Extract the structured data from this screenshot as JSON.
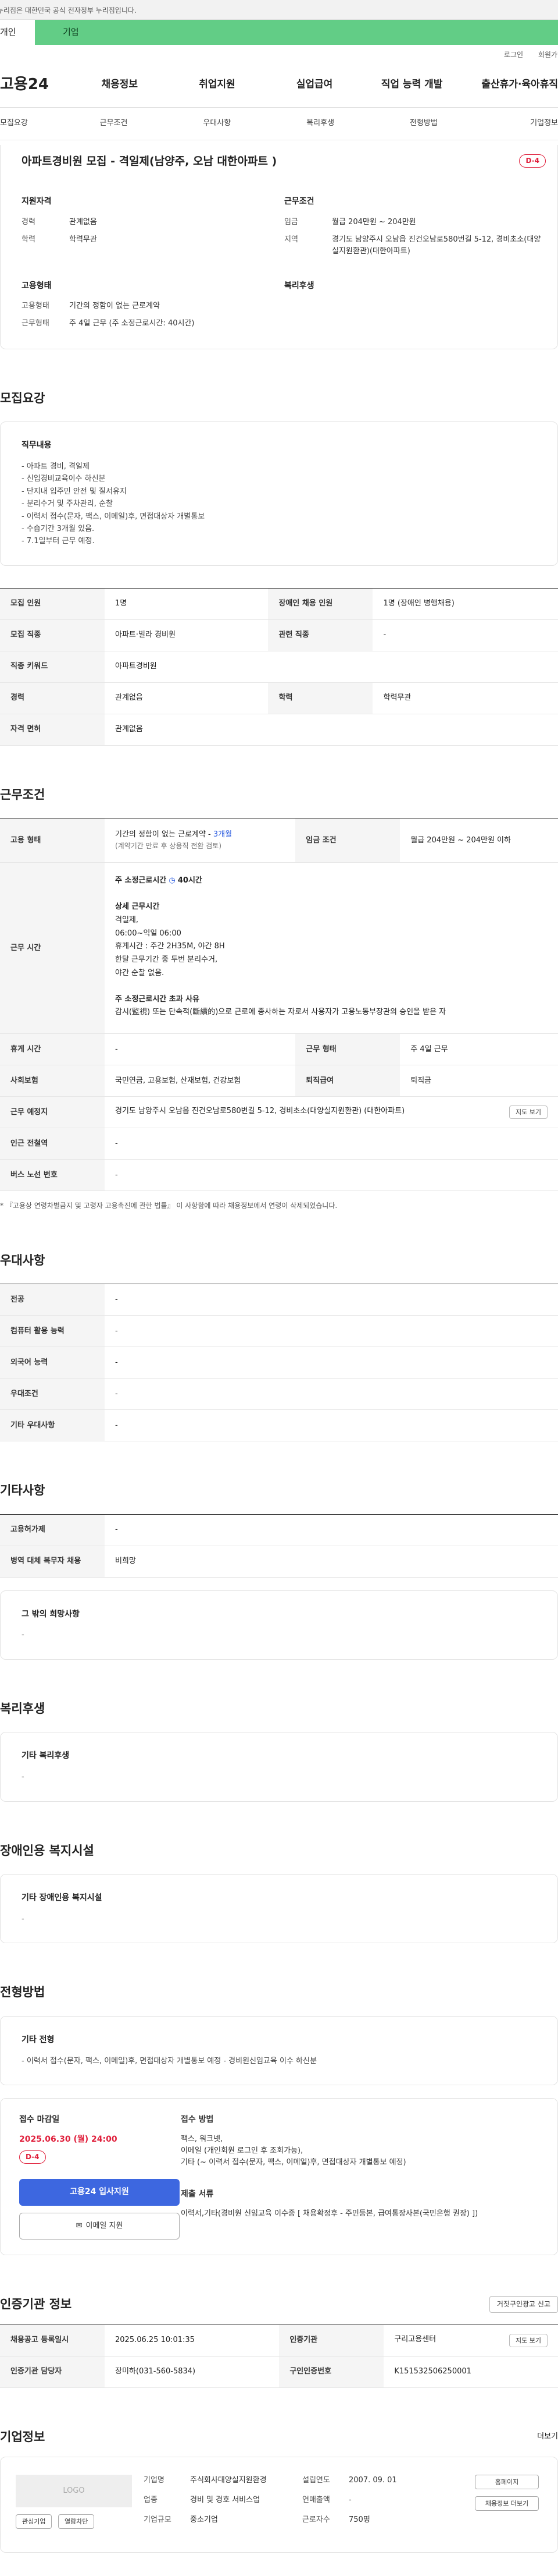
{
  "gov_bar": "이 누리집은 대한민국 공식 전자정부 누리집입니다.",
  "top_tabs": [
    "개인",
    "기업"
  ],
  "util": [
    "로그인",
    "회원가입"
  ],
  "gnb": {
    "logo": "고용24",
    "menus": [
      "채용정보",
      "취업지원",
      "실업급여",
      "직업 능력 개발",
      "출산휴가·육아휴직"
    ]
  },
  "snb": [
    "모집요강",
    "근무조건",
    "우대사항",
    "복리후생",
    "전형방법",
    "기업정보"
  ],
  "summary": {
    "title": "아파트경비원 모집 - 격일제(남양주, 오남 대한아파트 )",
    "dday": "D-4",
    "qual_h": "지원자격",
    "qual": [
      {
        "k": "경력",
        "v": "관계없음"
      },
      {
        "k": "학력",
        "v": "학력무관"
      }
    ],
    "cond_h": "근무조건",
    "cond": [
      {
        "k": "임금",
        "v": "월급 204만원 ~ 204만원"
      },
      {
        "k": "지역",
        "v": "경기도 남양주시 오남읍 진건오남로580번길 5-12, 경비초소(대양실지원환관)(대한아파트)"
      }
    ],
    "emp_h": "고용형태",
    "emp": [
      {
        "k": "고용형태",
        "v": "기간의 정함이 없는 근로계약"
      },
      {
        "k": "근무형태",
        "v": "주 4일 근무 (주 소정근로시간: 40시간)"
      }
    ],
    "welfare_h": "복리후생"
  },
  "recruit": {
    "title": "모집요강",
    "duty_h": "직무내용",
    "duty_lines": [
      "- 아파트 경비, 격일제",
      "- 신입경비교육이수 하신분",
      "- 단지내 입주민 안전 및 질서유지",
      "- 분리수거 및 주차관리, 순찰",
      "- 이력서 접수(문자, 팩스, 이메일)후, 면접대상자 개별통보",
      "- 수습기간 3개월 있음.",
      "- 7.1일부터 근무 예정."
    ],
    "rows": [
      [
        "모집 인원",
        "1명",
        "장애인 채용 인원",
        "1명 (장애인 병행채용)"
      ],
      [
        "모집 직종",
        "아파트·빌라 경비원",
        "관련 직종",
        "-"
      ],
      [
        "직종 키워드",
        "아파트경비원",
        "",
        ""
      ],
      [
        "경력",
        "관계없음",
        "학력",
        "학력무관"
      ],
      [
        "자격 면허",
        "관계없음",
        "",
        ""
      ]
    ]
  },
  "work": {
    "title": "근무조건",
    "emp_k": "고용 형태",
    "emp_v1": "기간의 정함이 없는 근로계약 - ",
    "emp_v1b": "3개월",
    "emp_v2": "(계약기간 만료 후 상용직 전환 검토)",
    "wage_k": "임금 조건",
    "wage_v": "월급 204만원 ~ 204만원 이하",
    "time_k": "근무 시간",
    "time_lines": [
      "주 소정근로시간",
      "40시간",
      "상세 근무시간",
      "격일제,",
      "06:00~익일 06:00",
      "휴게시간 : 주간 2H35M, 야간 8H",
      "한달 근무기간 중 두번 분리수거,",
      "야간 순찰 없음.",
      "주 소정근로시간 초과 사유",
      "감시(監視) 또는 단속적(斷續的)으로 근로에 종사하는 자로서 사용자가 고용노동부장관의 승인을 받은 자"
    ],
    "rows": [
      [
        "휴게 시간",
        "-",
        "근무 형태",
        "주 4일 근무"
      ],
      [
        "사회보험",
        "국민연금, 고용보험, 산재보험, 건강보험",
        "퇴직급여",
        "퇴직금"
      ]
    ],
    "place_k": "근무 예정지",
    "place_v": "경기도 남양주시 오남읍 진건오남로580번길 5-12, 경비초소(대양실지원환관) (대한아파트)",
    "map_btn": "지도 보기",
    "single": [
      [
        "인근 전철역",
        "-"
      ],
      [
        "버스 노선 번호",
        "-"
      ]
    ],
    "note": "* 『고용상 연령차별금지 및 고령자 고용촉진에 관한 법률』 이 사항함에 따라 채용정보에서 연령이 삭제되었습니다."
  },
  "pref": {
    "title": "우대사항",
    "rows": [
      [
        "전공",
        "-"
      ],
      [
        "컴퓨터 활용 능력",
        "-"
      ],
      [
        "외국어 능력",
        "-"
      ],
      [
        "우대조건",
        "-"
      ],
      [
        "기타 우대사항",
        "-"
      ]
    ]
  },
  "etc": {
    "title": "기타사항",
    "rows": [
      [
        "고용허가제",
        "-"
      ],
      [
        "병역 대체 복무자 채용",
        "비희망"
      ]
    ],
    "box_h": "그 밖의 희망사항",
    "box_v": "-"
  },
  "welfare": {
    "title": "복리후생",
    "box_h": "기타 복리후생",
    "box_v": "-"
  },
  "disabled": {
    "title": "장애인용 복지시설",
    "box_h": "기타 장애인용 복지시설",
    "box_v": "-"
  },
  "process": {
    "title": "전형방법",
    "box_h": "기타 전형",
    "box_v": "- 이력서 접수(문자, 팩스, 이메일)후, 면접대상자 개별통보 예정 - 경비원신임교육 이수 하신분",
    "deadline_h": "접수 마감일",
    "deadline_v": "2025.06.30 (월) 24:00",
    "dday": "D-4",
    "apply_btn": "고용24 입사지원",
    "email_btn": "이메일 지원",
    "method_h": "접수 방법",
    "method_lines": [
      "팩스, 워크넷,",
      "이메일 (개인회원 로그인 후 조회가능),",
      "기타 (~ 이력서 접수(문자, 팩스, 이메일)후, 면접대상자 개별통보 예정)"
    ],
    "docs_h": "제출 서류",
    "docs_v": "이력서,기타(경비원 신임교육 이수증  [ 채용확정후 - 주민등본, 급여통장사본(국민은행 권장) ])"
  },
  "agency": {
    "title": "인증기관 정보",
    "report_btn": "거짓구인광고 신고",
    "rows": [
      [
        "채용공고 등록일시",
        "2025.06.25 10:01:35",
        "인증기관",
        "구리고용센터"
      ],
      [
        "인증기관 담당자",
        "장미하(031-560-5834)",
        "구인인증번호",
        "K151532506250001"
      ]
    ],
    "map_btn": "지도 보기"
  },
  "company": {
    "title": "기업정보",
    "more": "더보기",
    "logo": "LOGO",
    "fav_btn": "관심기업",
    "block_btn": "열람차단",
    "col1": [
      {
        "k": "기업명",
        "v": "주식회사대양실지원환경"
      },
      {
        "k": "업종",
        "v": "경비 및 경호 서비스업"
      },
      {
        "k": "기업규모",
        "v": "중소기업"
      }
    ],
    "col2": [
      {
        "k": "설립연도",
        "v": "2007. 09. 01"
      },
      {
        "k": "연매출액",
        "v": "-"
      },
      {
        "k": "근로자수",
        "v": "750명"
      }
    ],
    "home_btn": "홈페이지",
    "list_btn": "채용정보 더보기"
  }
}
